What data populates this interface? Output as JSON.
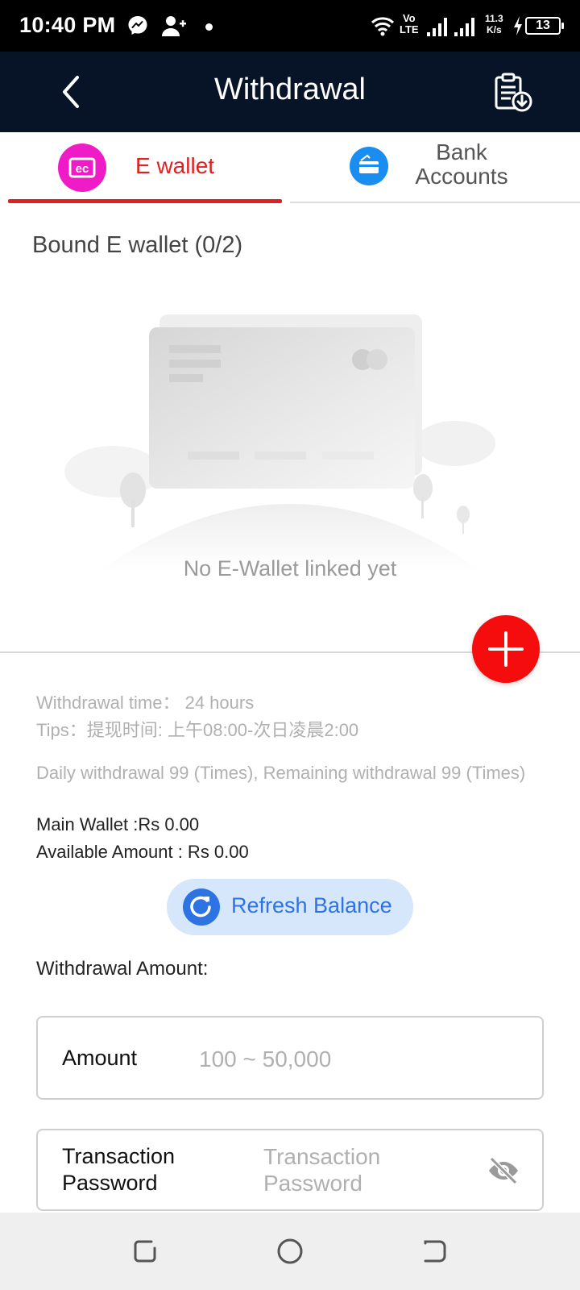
{
  "status_bar": {
    "time": "10:40 PM",
    "network_line1": "Vo",
    "network_line2": "LTE",
    "speed_value": "11.3",
    "speed_unit": "K/s",
    "battery": "13"
  },
  "header": {
    "title": "Withdrawal",
    "back_icon": "chevron-left-icon",
    "history_icon": "clipboard-download-icon"
  },
  "tabs": [
    {
      "label": "E wallet",
      "active": true,
      "icon": "ewallet-icon",
      "color": "#ee1bc6"
    },
    {
      "label_line1": "Bank",
      "label_line2": "Accounts",
      "active": false,
      "icon": "bank-card-icon",
      "color": "#1a8ef0"
    }
  ],
  "bound": {
    "title": "Bound E wallet (0/2)",
    "empty_text": "No E-Wallet linked yet"
  },
  "info": {
    "withdrawal_time": "Withdrawal time：  24 hours",
    "tips": "Tips：提现时间: 上午08:00-次日凌晨2:00",
    "daily": "Daily withdrawal 99 (Times), Remaining withdrawal 99 (Times)",
    "main_wallet": "Main Wallet :Rs 0.00",
    "available": "Available Amount : Rs 0.00"
  },
  "refresh": {
    "label": "Refresh Balance"
  },
  "form": {
    "section_title": "Withdrawal Amount:",
    "amount_label": "Amount",
    "amount_placeholder": "100 ~ 50,000",
    "password_label_line1": "Transaction",
    "password_label_line2": "Password",
    "password_placeholder": "Transaction Password"
  },
  "colors": {
    "accent_red": "#e02020",
    "header_bg": "#071428",
    "add_button": "#f50d0d",
    "refresh_blue": "#2d73e4"
  }
}
